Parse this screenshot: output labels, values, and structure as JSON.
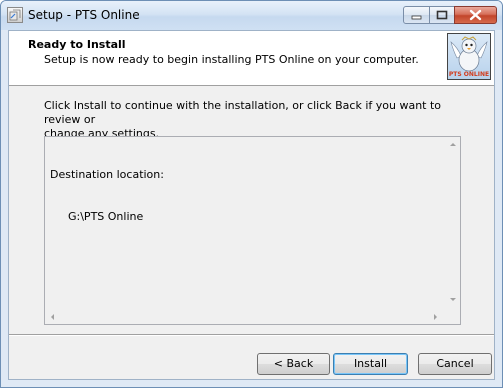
{
  "window": {
    "title": "Setup - PTS Online"
  },
  "header": {
    "title": "Ready to Install",
    "subtitle": "Setup is now ready to begin installing PTS Online on your computer.",
    "logo_text": "PTS ONLINE"
  },
  "body": {
    "intro_line1": "Click Install to continue with the installation, or click Back if you want to review or",
    "intro_line2": "change any settings.",
    "memo": {
      "label": "Destination location:",
      "value": "G:\\PTS Online"
    }
  },
  "buttons": {
    "back": "< Back",
    "install": "Install",
    "cancel": "Cancel"
  },
  "colors": {
    "close_button": "#c2452b",
    "default_button_border": "#3c7fb1",
    "titlebar": "#d4e3f4"
  }
}
